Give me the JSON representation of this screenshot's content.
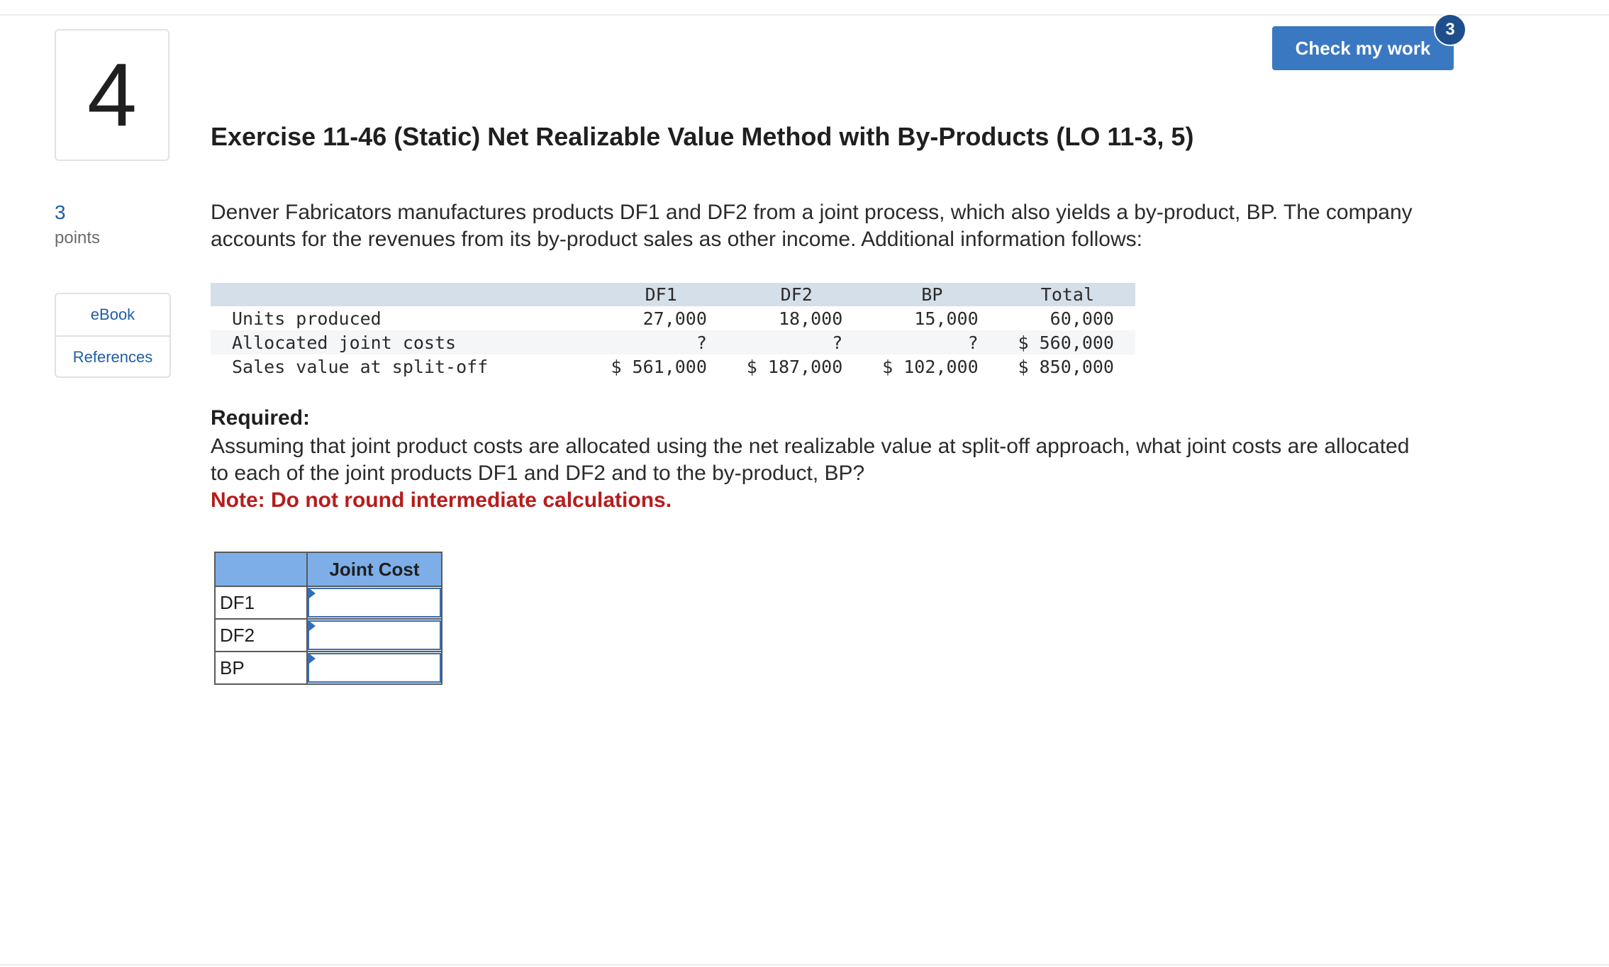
{
  "question": {
    "number": "4",
    "points_value": "3",
    "points_label": "points"
  },
  "side_links": {
    "ebook": "eBook",
    "references": "References"
  },
  "header": {
    "check_button": "Check my work",
    "badge_count": "3"
  },
  "exercise": {
    "title": "Exercise 11-46 (Static) Net Realizable Value Method with By-Products (LO 11-3, 5)",
    "intro": "Denver Fabricators manufactures products DF1 and DF2 from a joint process, which also yields a by-product, BP. The company accounts for the revenues from its by-product sales as other income. Additional information follows:"
  },
  "data_table": {
    "columns": [
      "DF1",
      "DF2",
      "BP",
      "Total"
    ],
    "rows": [
      {
        "label": "Units produced",
        "values": [
          "27,000",
          "18,000",
          "15,000",
          "60,000"
        ]
      },
      {
        "label": "Allocated joint costs",
        "values": [
          "?",
          "?",
          "?",
          "$ 560,000"
        ]
      },
      {
        "label": "Sales value at split-off",
        "values": [
          "$ 561,000",
          "$ 187,000",
          "$ 102,000",
          "$ 850,000"
        ]
      }
    ]
  },
  "required": {
    "label": "Required:",
    "text": "Assuming that joint product costs are allocated using the net realizable value at split-off approach, what joint costs are allocated to each of the joint products DF1 and DF2 and to the by-product, BP?",
    "note": "Note: Do not round intermediate calculations."
  },
  "answer_table": {
    "header_blank": "",
    "header": "Joint Cost",
    "rows": [
      {
        "label": "DF1",
        "value": ""
      },
      {
        "label": "DF2",
        "value": ""
      },
      {
        "label": "BP",
        "value": ""
      }
    ]
  },
  "colors": {
    "primary_button": "#3a78c2",
    "badge": "#1e4f8c",
    "table_header": "#d5dfe9",
    "answer_header": "#7daee8",
    "note_red": "#b71c1c",
    "link_blue": "#1f5fa8"
  }
}
